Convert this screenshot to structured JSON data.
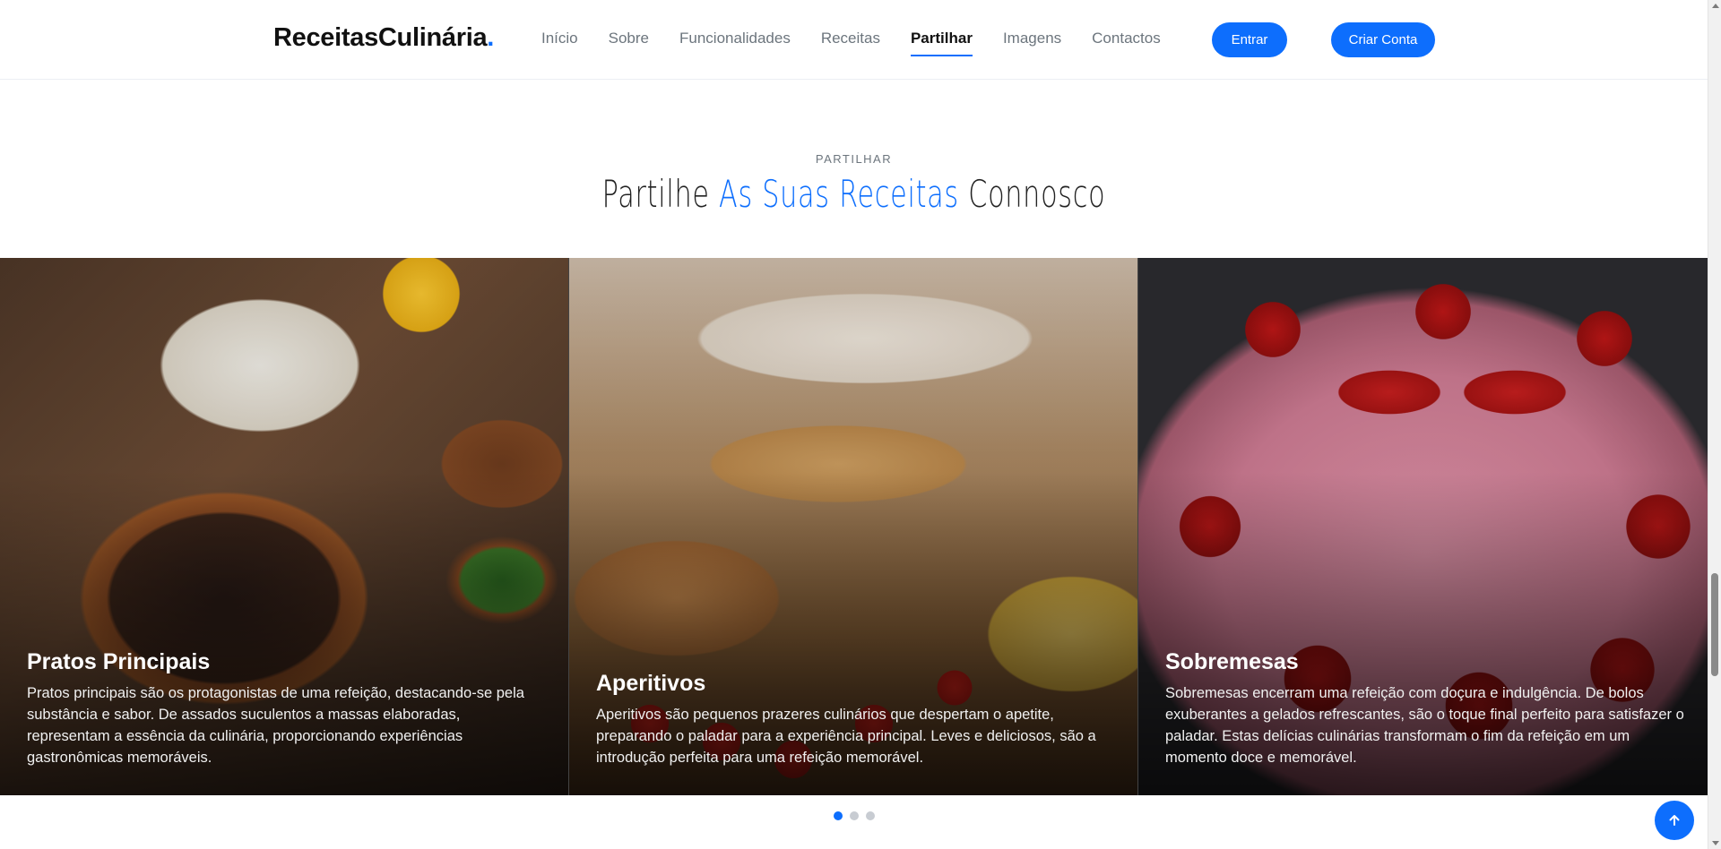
{
  "header": {
    "logo_text": "ReceitasCulinária",
    "logo_dot": ".",
    "nav": [
      {
        "label": "Início",
        "active": false
      },
      {
        "label": "Sobre",
        "active": false
      },
      {
        "label": "Funcionalidades",
        "active": false
      },
      {
        "label": "Receitas",
        "active": false
      },
      {
        "label": "Partilhar",
        "active": true
      },
      {
        "label": "Imagens",
        "active": false
      },
      {
        "label": "Contactos",
        "active": false
      }
    ],
    "login_label": "Entrar",
    "signup_label": "Criar Conta"
  },
  "section": {
    "eyebrow": "PARTILHAR",
    "title_pre": "Partilhe ",
    "title_accent": "As Suas Receitas",
    "title_post": " Connosco"
  },
  "cards": [
    {
      "title": "Pratos Principais",
      "text": "Pratos principais são os protagonistas de uma refeição, destacando-se pela substância e sabor. De assados suculentos a massas elaboradas, representam a essência da culinária, proporcionando experiências gastronômicas memoráveis."
    },
    {
      "title": "Aperitivos",
      "text": "Aperitivos são pequenos prazeres culinários que despertam o apetite, preparando o paladar para a experiência principal. Leves e deliciosos, são a introdução perfeita para uma refeição memorável."
    },
    {
      "title": "Sobremesas",
      "text": "Sobremesas encerram uma refeição com doçura e indulgência. De bolos exuberantes a gelados refrescantes, são o toque final perfeito para satisfazer o paladar. Estas delícias culinárias transformam o fim da refeição em um momento doce e memorável."
    }
  ],
  "carousel": {
    "active_index": 0,
    "count": 3
  },
  "icons": {
    "back_to_top": "arrow-up-icon"
  },
  "colors": {
    "accent": "#0d6efd",
    "text_dark": "#111111",
    "nav_text": "#6c757d"
  }
}
